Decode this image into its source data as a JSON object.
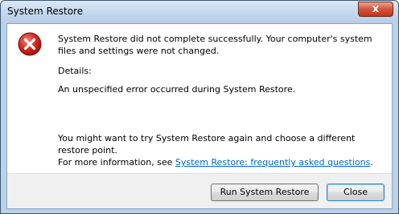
{
  "window": {
    "title": "System Restore",
    "close_glyph": "x"
  },
  "content": {
    "icon": "error-icon",
    "message": "System Restore did not complete successfully. Your computer's system files and settings were not changed.",
    "details_label": "Details:",
    "details_text": "An unspecified error occurred during System Restore.",
    "hint_line1": "You might want to try System Restore again and choose a different restore point.",
    "hint_prefix": "For more information, see ",
    "faq_link": "System Restore: frequently asked questions",
    "hint_suffix": "."
  },
  "buttons": {
    "run_label": "Run System Restore",
    "close_label": "Close"
  },
  "colors": {
    "error_red": "#d42a20",
    "link_blue": "#0066cc",
    "frame_blue": "#b9d1ea"
  }
}
